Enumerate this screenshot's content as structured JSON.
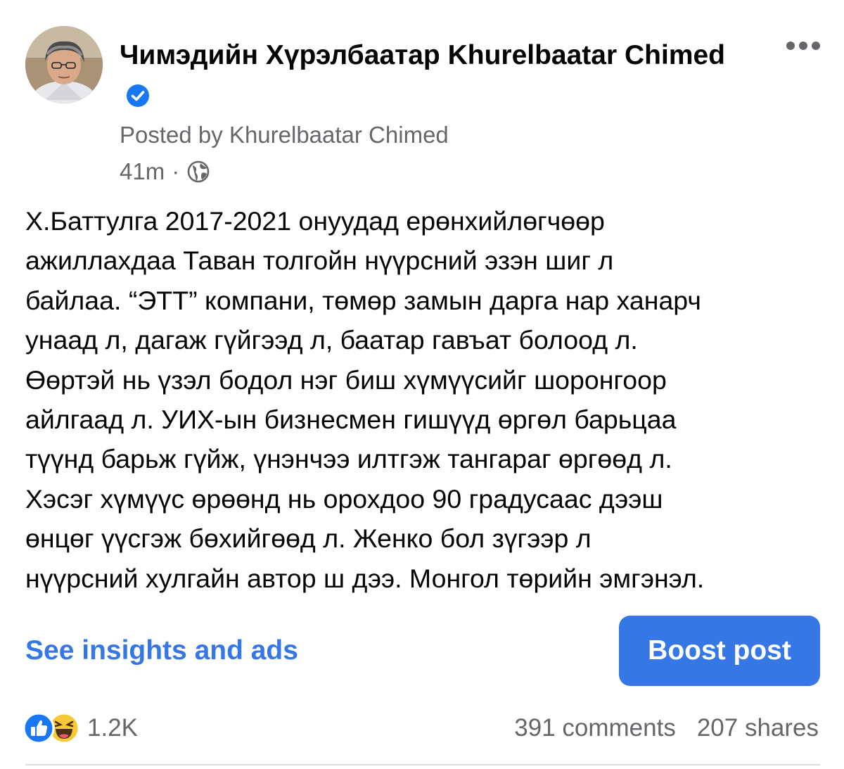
{
  "post": {
    "author_name": "Чимэдийн Хүрэлбаатар Khurelbaatar Chimed",
    "posted_by": "Posted by Khurelbaatar Chimed",
    "time": "41m",
    "separator": "·",
    "text_lines": [
      "Х.Баттулга 2017-2021 онуудад ерөнхийлөгчөөр",
      "ажиллахдаа Таван толгойн нүүрсний эзэн шиг л",
      "байлаа. “ЭТТ” компани, төмөр замын дарга нар ханарч",
      "унаад л, дагаж гүйгээд л, баатар гавъат болоод л.",
      "Өөртэй нь үзэл бодол нэг биш хүмүүсийг шоронгоор",
      "айлгаад л. УИХ-ын бизнесмен гишүүд өргөл барьцаа",
      "түүнд барьж гүйж, үнэнчээ илтгэж тангараг өргөөд л.",
      "Хэсэг хүмүүс өрөөнд нь орохдоо 90 градусаас дээш",
      "өнцөг үүсгэж бөхийгөөд л. Женко бол зүгээр л",
      "нүүрсний хулгайн автор ш дээ. Монгол төрийн эмгэнэл."
    ]
  },
  "actions": {
    "insights_label": "See insights and ads",
    "boost_label": "Boost post"
  },
  "engagement": {
    "reaction_count": "1.2K",
    "comments": "391 comments",
    "shares": "207 shares"
  },
  "icons": {
    "verified": "verified-badge-icon",
    "more": "more-options-icon",
    "audience": "globe-icon",
    "reactions": [
      "like-icon",
      "haha-icon"
    ]
  },
  "colors": {
    "accent": "#3578e5",
    "secondary_text": "#65676b",
    "verified": "#1877f2"
  }
}
